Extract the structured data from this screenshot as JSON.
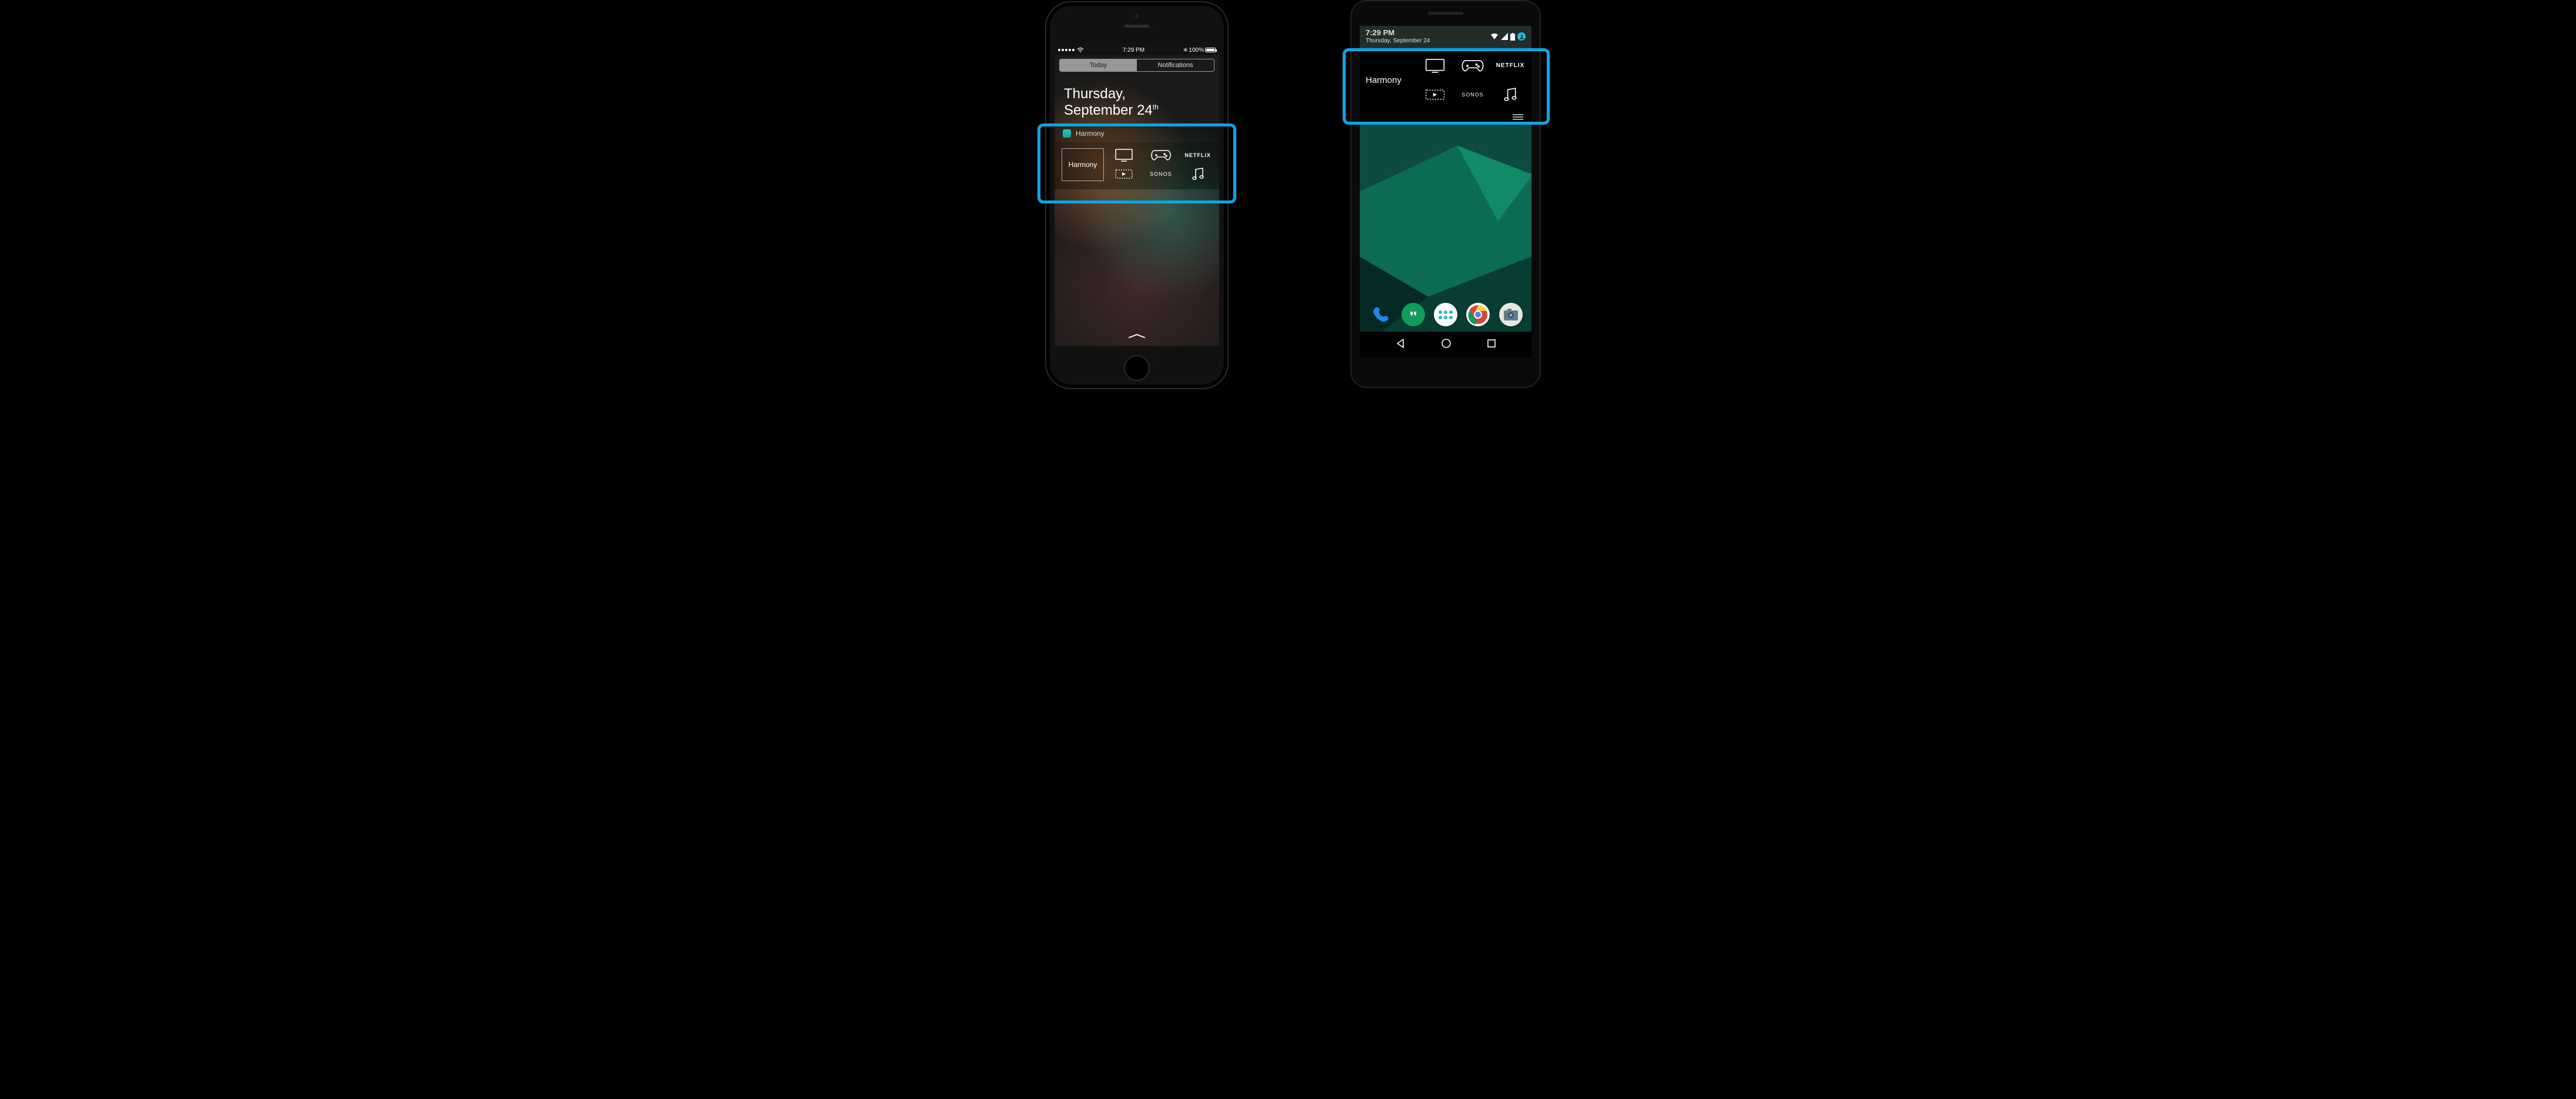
{
  "colors": {
    "highlight": "#08a8e6"
  },
  "iphone": {
    "status": {
      "time": "7:29 PM",
      "battery": "100%"
    },
    "tabs": {
      "today": "Today",
      "notifications": "Notifications"
    },
    "date_line1": "Thursday,",
    "date_line2": "September 24",
    "date_suffix": "th",
    "widget": {
      "app_name": "Harmony",
      "big_label": "Harmony",
      "activities": [
        {
          "id": "tv",
          "kind": "icon",
          "icon": "tv"
        },
        {
          "id": "game",
          "kind": "icon",
          "icon": "gamepad"
        },
        {
          "id": "netflix",
          "kind": "text",
          "label": "NETFLIX"
        },
        {
          "id": "stream",
          "kind": "icon",
          "icon": "streambox"
        },
        {
          "id": "sonos",
          "kind": "text",
          "label": "SONOS"
        },
        {
          "id": "music",
          "kind": "icon",
          "icon": "music"
        }
      ]
    }
  },
  "android": {
    "status": {
      "time": "7:29 PM",
      "date": "Thursday, September 24"
    },
    "widget": {
      "title": "Harmony",
      "activities": [
        {
          "id": "tv",
          "kind": "icon",
          "icon": "tv"
        },
        {
          "id": "game",
          "kind": "icon",
          "icon": "gamepad"
        },
        {
          "id": "netflix",
          "kind": "text",
          "label": "NETFLIX"
        },
        {
          "id": "stream",
          "kind": "icon",
          "icon": "streambox"
        },
        {
          "id": "sonos",
          "kind": "text",
          "label": "SONOS"
        },
        {
          "id": "music",
          "kind": "icon",
          "icon": "music"
        }
      ]
    },
    "favorites": [
      "phone",
      "hangouts",
      "drawer",
      "chrome",
      "camera"
    ]
  }
}
